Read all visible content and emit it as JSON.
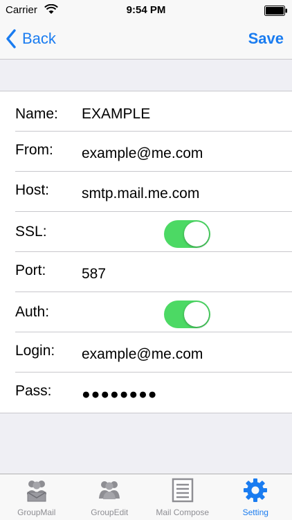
{
  "status_bar": {
    "carrier": "Carrier",
    "time": "9:54 PM",
    "wifi_icon": "wifi-icon",
    "battery_icon": "battery-icon"
  },
  "nav": {
    "back_label": "Back",
    "back_icon": "chevron-left-icon",
    "save_label": "Save"
  },
  "form": {
    "name": {
      "label": "Name:",
      "value": "EXAMPLE"
    },
    "from": {
      "label": "From:",
      "value": "example@me.com"
    },
    "host": {
      "label": "Host:",
      "value": "smtp.mail.me.com"
    },
    "ssl": {
      "label": "SSL:",
      "enabled": true
    },
    "port": {
      "label": "Port:",
      "value": "587"
    },
    "auth": {
      "label": "Auth:",
      "enabled": true
    },
    "login": {
      "label": "Login:",
      "value": "example@me.com"
    },
    "pass": {
      "label": "Pass:",
      "value": "●●●●●●●●"
    }
  },
  "tabs": [
    {
      "label": "GroupMail",
      "icon": "group-mail-icon",
      "active": false
    },
    {
      "label": "GroupEdit",
      "icon": "group-edit-icon",
      "active": false
    },
    {
      "label": "Mail Compose",
      "icon": "compose-icon",
      "active": false
    },
    {
      "label": "Setting",
      "icon": "gear-icon",
      "active": true
    }
  ],
  "colors": {
    "accent": "#1a7cf0",
    "toggle_on": "#4cd964",
    "background": "#efeff4",
    "inactive_tab": "#8e8e93"
  }
}
